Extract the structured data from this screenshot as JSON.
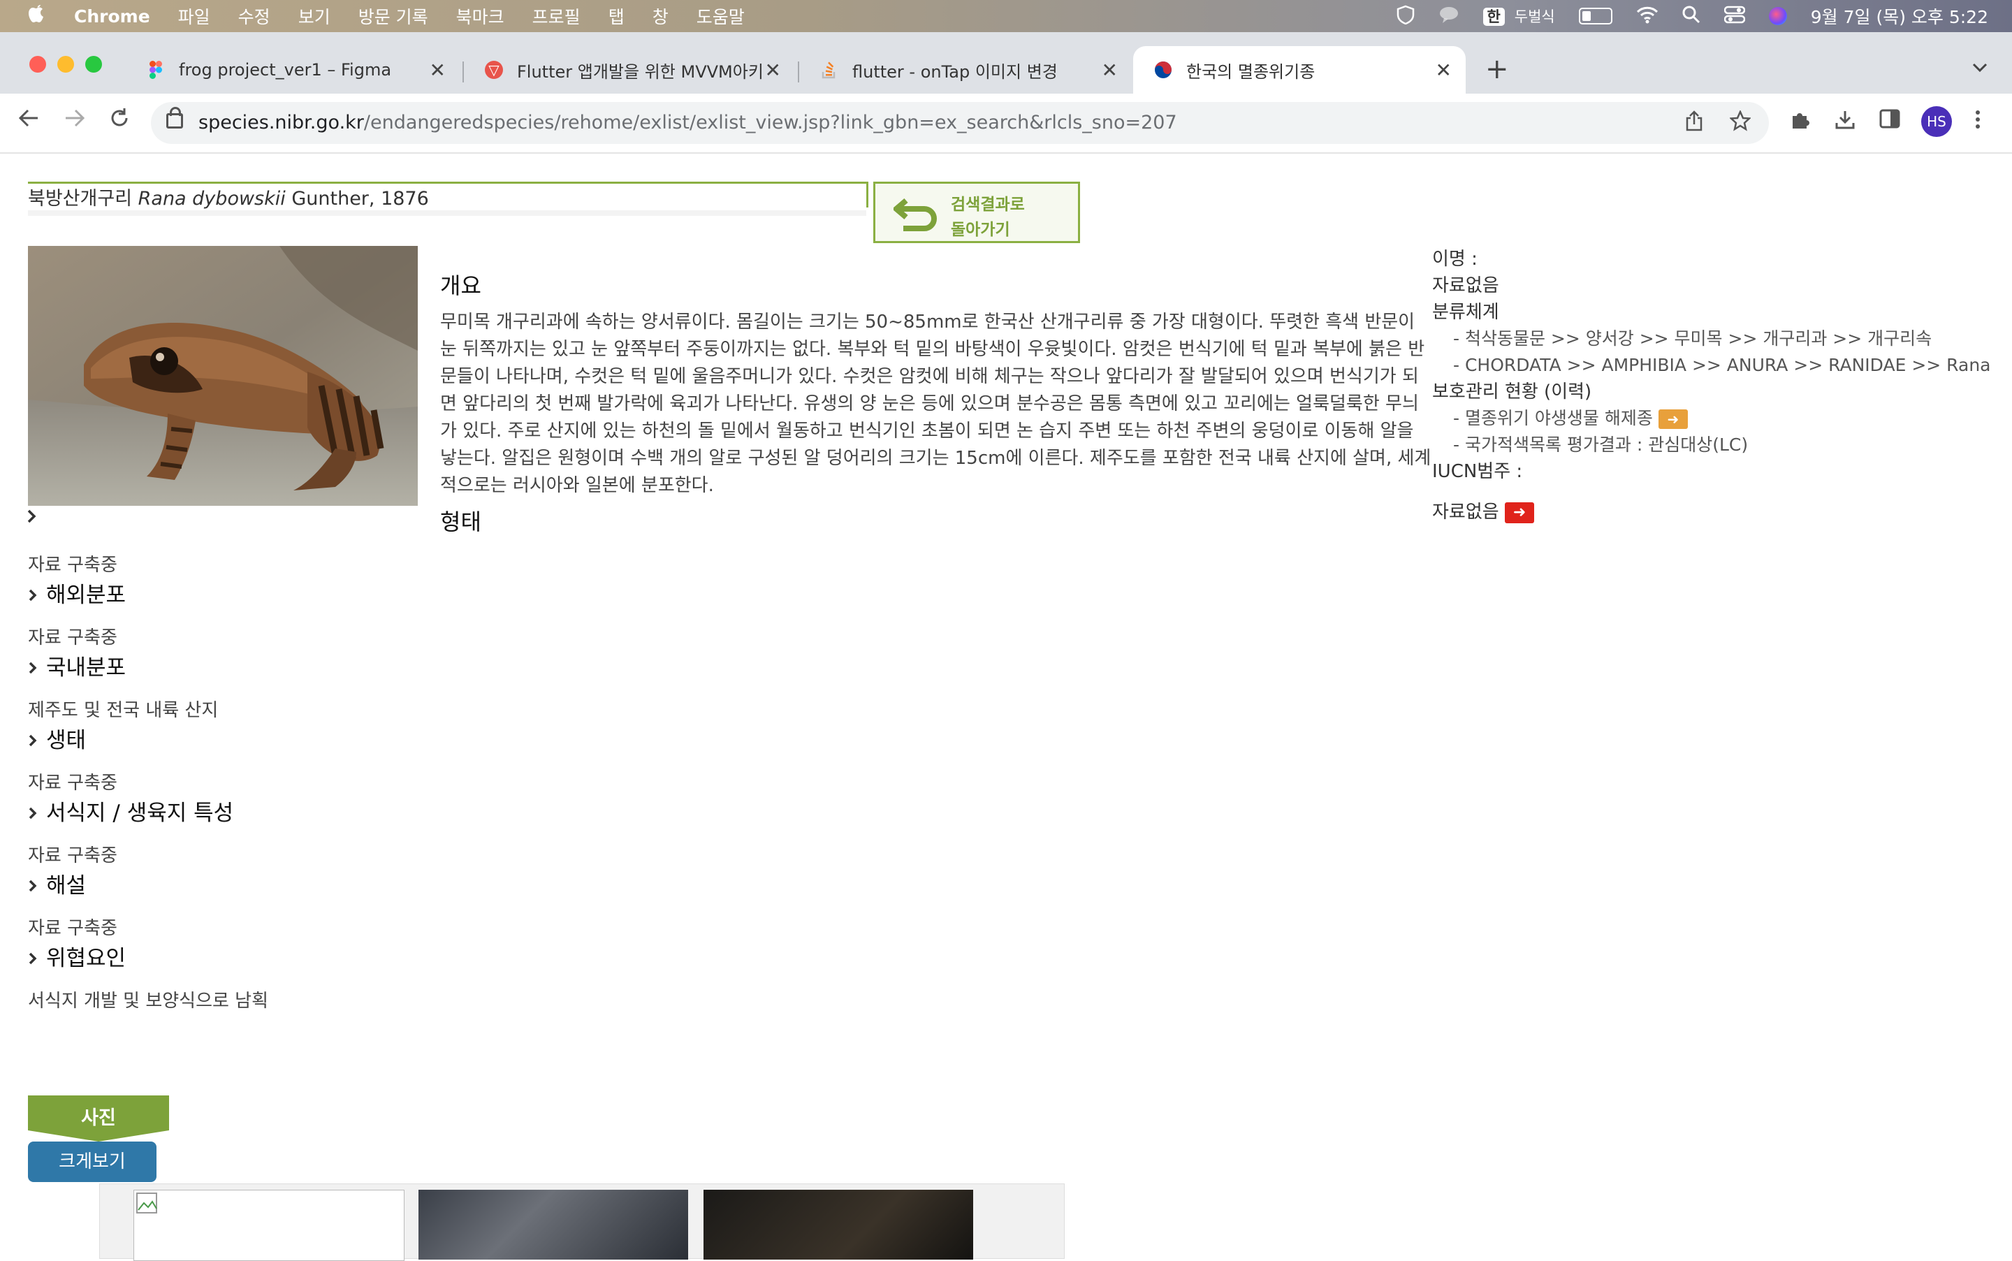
{
  "menubar": {
    "app_name": "Chrome",
    "menus": [
      "파일",
      "수정",
      "보기",
      "방문 기록",
      "북마크",
      "프로필",
      "탭",
      "창",
      "도움말"
    ],
    "input_method": "두벌식",
    "hangul_badge": "한",
    "datetime": "9월 7일 (목) 오후 5:22"
  },
  "tabs": [
    {
      "title": "frog project_ver1 – Figma",
      "icon": "figma-icon",
      "color": "#a259ff"
    },
    {
      "title": "Flutter 앱개발을 위한 MVVM아키텍",
      "icon": "velog-icon",
      "color": "#e8544b"
    },
    {
      "title": "flutter - onTap 이미지 변경",
      "icon": "stackoverflow-icon",
      "color": "#f48024"
    },
    {
      "title": "한국의 멸종위기종",
      "icon": "taegeuk-icon",
      "color": "#cd2e3a"
    }
  ],
  "toolbar": {
    "url_domain": "species.nibr.go.kr",
    "url_path": "/endangeredspecies/rehome/exlist/exlist_view.jsp?link_gbn=ex_search&rlcls_sno=207",
    "avatar_initials": "HS"
  },
  "species": {
    "korean_name": "북방산개구리",
    "scientific_name": "Rana dybowskii",
    "author": "Gunther, 1876"
  },
  "back_button": {
    "line1": "검색결과로",
    "line2": "돌아가기"
  },
  "left_sections": [
    {
      "sub": "자료 구축중",
      "head": "해외분포"
    },
    {
      "sub": "자료 구축중",
      "head": "국내분포"
    },
    {
      "sub": "제주도 및 전국 내륙 산지",
      "head": "생태"
    },
    {
      "sub": "자료 구축중",
      "head": "서식지 / 생육지 특성"
    },
    {
      "sub": "자료 구축중",
      "head": "해설"
    },
    {
      "sub": "자료 구축중",
      "head": "위협요인"
    }
  ],
  "threat_text": "서식지 개발 및 보양식으로 남획",
  "overview": {
    "title": "개요",
    "text": "무미목 개구리과에 속하는 양서류이다. 몸길이는 크기는 50~85mm로 한국산 산개구리류 중 가장 대형이다. 뚜렷한 흑색 반문이 눈 뒤쪽까지는 있고 눈 앞쪽부터 주둥이까지는 없다. 복부와 턱 밑의 바탕색이 우윳빛이다. 암컷은 번식기에 턱 밑과 복부에 붉은 반문들이 나타나며, 수컷은 턱 밑에 울음주머니가 있다. 수컷은 암컷에 비해 체구는 작으나 앞다리가 잘 발달되어 있으며 번식기가 되면 앞다리의 첫 번째 발가락에 육괴가 나타난다. 유생의 양 눈은 등에 있으며 분수공은 몸통 측면에 있고 꼬리에는 얼룩덜룩한 무늬가 있다. 주로 산지에 있는 하천의 돌 밑에서 월동하고 번식기인 초봄이 되면 논 습지 주변 또는 하천 주변의 웅덩이로 이동해 알을 낳는다. 알집은 원형이며 수백 개의 알로 구성된 알 덩어리의 크기는 15cm에 이른다. 제주도를 포함한 전국 내륙 산지에 살며, 세계적으로는 러시아와 일본에 분포한다.",
    "form_title": "형태"
  },
  "right_panel": {
    "alias_label": "이명 :",
    "alias_value": "자료없음",
    "taxonomy_label": "분류체계",
    "taxonomy_kr": "- 척삭동물문 >> 양서강 >> 무미목 >> 개구리과 >> 개구리속",
    "taxonomy_en": "- CHORDATA >> AMPHIBIA >> ANURA >> RANIDAE >> Rana",
    "protection_label": "보호관리 현황 (이력)",
    "protection_item1": "- 멸종위기 야생생물 해제종",
    "protection_item2": "- 국가적색목록 평가결과 : 관심대상(LC)",
    "iucn_label": "IUCN범주 :",
    "iucn_value": "자료없음"
  },
  "photo_section": {
    "tab_label": "사진",
    "zoom_button": "크게보기"
  }
}
